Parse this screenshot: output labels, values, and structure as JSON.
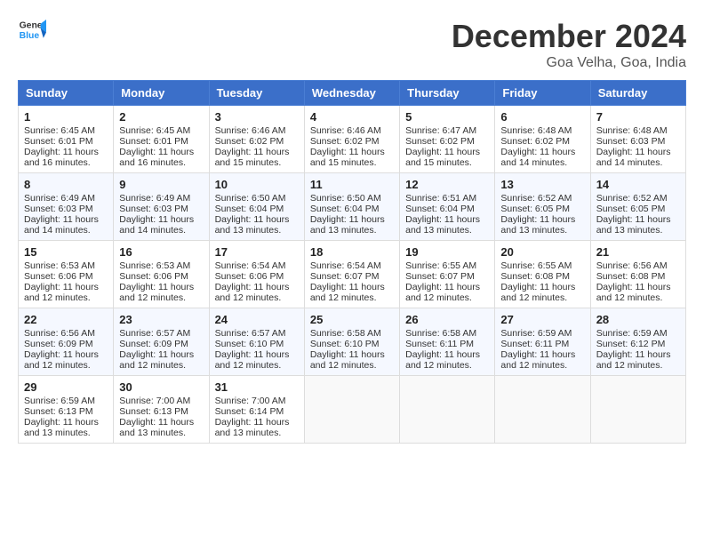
{
  "header": {
    "logo_line1": "General",
    "logo_line2": "Blue",
    "month_title": "December 2024",
    "location": "Goa Velha, Goa, India"
  },
  "weekdays": [
    "Sunday",
    "Monday",
    "Tuesday",
    "Wednesday",
    "Thursday",
    "Friday",
    "Saturday"
  ],
  "weeks": [
    [
      {
        "day": "1",
        "sunrise": "6:45 AM",
        "sunset": "6:01 PM",
        "daylight": "11 hours and 16 minutes."
      },
      {
        "day": "2",
        "sunrise": "6:45 AM",
        "sunset": "6:01 PM",
        "daylight": "11 hours and 16 minutes."
      },
      {
        "day": "3",
        "sunrise": "6:46 AM",
        "sunset": "6:02 PM",
        "daylight": "11 hours and 15 minutes."
      },
      {
        "day": "4",
        "sunrise": "6:46 AM",
        "sunset": "6:02 PM",
        "daylight": "11 hours and 15 minutes."
      },
      {
        "day": "5",
        "sunrise": "6:47 AM",
        "sunset": "6:02 PM",
        "daylight": "11 hours and 15 minutes."
      },
      {
        "day": "6",
        "sunrise": "6:48 AM",
        "sunset": "6:02 PM",
        "daylight": "11 hours and 14 minutes."
      },
      {
        "day": "7",
        "sunrise": "6:48 AM",
        "sunset": "6:03 PM",
        "daylight": "11 hours and 14 minutes."
      }
    ],
    [
      {
        "day": "8",
        "sunrise": "6:49 AM",
        "sunset": "6:03 PM",
        "daylight": "11 hours and 14 minutes."
      },
      {
        "day": "9",
        "sunrise": "6:49 AM",
        "sunset": "6:03 PM",
        "daylight": "11 hours and 14 minutes."
      },
      {
        "day": "10",
        "sunrise": "6:50 AM",
        "sunset": "6:04 PM",
        "daylight": "11 hours and 13 minutes."
      },
      {
        "day": "11",
        "sunrise": "6:50 AM",
        "sunset": "6:04 PM",
        "daylight": "11 hours and 13 minutes."
      },
      {
        "day": "12",
        "sunrise": "6:51 AM",
        "sunset": "6:04 PM",
        "daylight": "11 hours and 13 minutes."
      },
      {
        "day": "13",
        "sunrise": "6:52 AM",
        "sunset": "6:05 PM",
        "daylight": "11 hours and 13 minutes."
      },
      {
        "day": "14",
        "sunrise": "6:52 AM",
        "sunset": "6:05 PM",
        "daylight": "11 hours and 13 minutes."
      }
    ],
    [
      {
        "day": "15",
        "sunrise": "6:53 AM",
        "sunset": "6:06 PM",
        "daylight": "11 hours and 12 minutes."
      },
      {
        "day": "16",
        "sunrise": "6:53 AM",
        "sunset": "6:06 PM",
        "daylight": "11 hours and 12 minutes."
      },
      {
        "day": "17",
        "sunrise": "6:54 AM",
        "sunset": "6:06 PM",
        "daylight": "11 hours and 12 minutes."
      },
      {
        "day": "18",
        "sunrise": "6:54 AM",
        "sunset": "6:07 PM",
        "daylight": "11 hours and 12 minutes."
      },
      {
        "day": "19",
        "sunrise": "6:55 AM",
        "sunset": "6:07 PM",
        "daylight": "11 hours and 12 minutes."
      },
      {
        "day": "20",
        "sunrise": "6:55 AM",
        "sunset": "6:08 PM",
        "daylight": "11 hours and 12 minutes."
      },
      {
        "day": "21",
        "sunrise": "6:56 AM",
        "sunset": "6:08 PM",
        "daylight": "11 hours and 12 minutes."
      }
    ],
    [
      {
        "day": "22",
        "sunrise": "6:56 AM",
        "sunset": "6:09 PM",
        "daylight": "11 hours and 12 minutes."
      },
      {
        "day": "23",
        "sunrise": "6:57 AM",
        "sunset": "6:09 PM",
        "daylight": "11 hours and 12 minutes."
      },
      {
        "day": "24",
        "sunrise": "6:57 AM",
        "sunset": "6:10 PM",
        "daylight": "11 hours and 12 minutes."
      },
      {
        "day": "25",
        "sunrise": "6:58 AM",
        "sunset": "6:10 PM",
        "daylight": "11 hours and 12 minutes."
      },
      {
        "day": "26",
        "sunrise": "6:58 AM",
        "sunset": "6:11 PM",
        "daylight": "11 hours and 12 minutes."
      },
      {
        "day": "27",
        "sunrise": "6:59 AM",
        "sunset": "6:11 PM",
        "daylight": "11 hours and 12 minutes."
      },
      {
        "day": "28",
        "sunrise": "6:59 AM",
        "sunset": "6:12 PM",
        "daylight": "11 hours and 12 minutes."
      }
    ],
    [
      {
        "day": "29",
        "sunrise": "6:59 AM",
        "sunset": "6:13 PM",
        "daylight": "11 hours and 13 minutes."
      },
      {
        "day": "30",
        "sunrise": "7:00 AM",
        "sunset": "6:13 PM",
        "daylight": "11 hours and 13 minutes."
      },
      {
        "day": "31",
        "sunrise": "7:00 AM",
        "sunset": "6:14 PM",
        "daylight": "11 hours and 13 minutes."
      },
      null,
      null,
      null,
      null
    ]
  ]
}
